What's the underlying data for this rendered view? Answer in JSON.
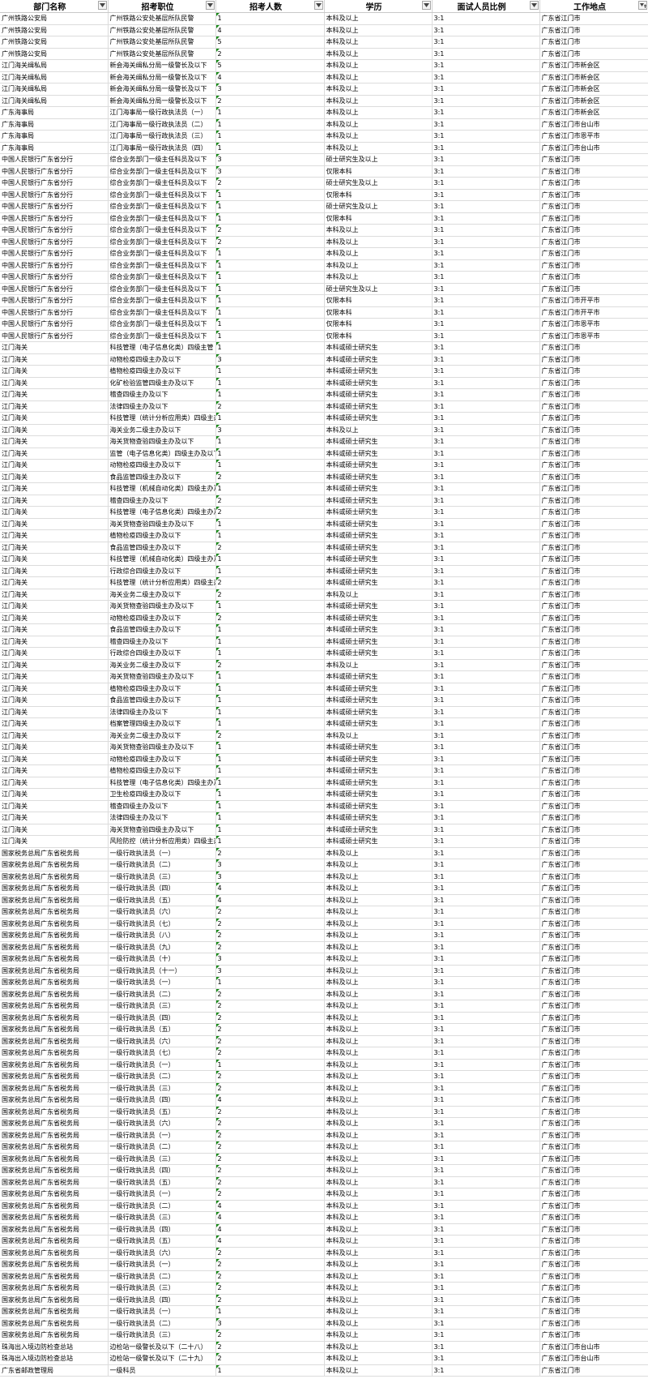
{
  "columns": [
    "部门名称",
    "招考职位",
    "招考人数",
    "学历",
    "面试人员比例",
    "工作地点"
  ],
  "rows": [
    [
      "广州铁路公安局",
      "广州铁路公安处基层所队民警",
      "1",
      "本科及以上",
      "3:1",
      "广东省江门市"
    ],
    [
      "广州铁路公安局",
      "广州铁路公安处基层所队民警",
      "4",
      "本科及以上",
      "3:1",
      "广东省江门市"
    ],
    [
      "广州铁路公安局",
      "广州铁路公安处基层所队民警",
      "5",
      "本科及以上",
      "3:1",
      "广东省江门市"
    ],
    [
      "广州铁路公安局",
      "广州铁路公安处基层所队民警",
      "2",
      "本科及以上",
      "3:1",
      "广东省江门市"
    ],
    [
      "江门海关缉私局",
      "新会海关缉私分局一级警长及以下",
      "5",
      "本科及以上",
      "3:1",
      "广东省江门市新会区"
    ],
    [
      "江门海关缉私局",
      "新会海关缉私分局一级警长及以下",
      "4",
      "本科及以上",
      "3:1",
      "广东省江门市新会区"
    ],
    [
      "江门海关缉私局",
      "新会海关缉私分局一级警长及以下",
      "3",
      "本科及以上",
      "3:1",
      "广东省江门市新会区"
    ],
    [
      "江门海关缉私局",
      "新会海关缉私分局一级警长及以下",
      "2",
      "本科及以上",
      "3:1",
      "广东省江门市新会区"
    ],
    [
      "广东海事局",
      "江门海事局一级行政执法员（一）",
      "1",
      "本科及以上",
      "3:1",
      "广东省江门市新会区"
    ],
    [
      "广东海事局",
      "江门海事局一级行政执法员（二）",
      "1",
      "本科及以上",
      "3:1",
      "广东省江门市台山市"
    ],
    [
      "广东海事局",
      "江门海事局一级行政执法员（三）",
      "1",
      "本科及以上",
      "3:1",
      "广东省江门市恩平市"
    ],
    [
      "广东海事局",
      "江门海事局一级行政执法员（四）",
      "1",
      "本科及以上",
      "3:1",
      "广东省江门市台山市"
    ],
    [
      "中国人民银行广东省分行",
      "综合业务部门一级主任科员及以下",
      "3",
      "硕士研究生及以上",
      "3:1",
      "广东省江门市"
    ],
    [
      "中国人民银行广东省分行",
      "综合业务部门一级主任科员及以下",
      "3",
      "仅限本科",
      "3:1",
      "广东省江门市"
    ],
    [
      "中国人民银行广东省分行",
      "综合业务部门一级主任科员及以下",
      "2",
      "硕士研究生及以上",
      "3:1",
      "广东省江门市"
    ],
    [
      "中国人民银行广东省分行",
      "综合业务部门一级主任科员及以下",
      "1",
      "仅限本科",
      "3:1",
      "广东省江门市"
    ],
    [
      "中国人民银行广东省分行",
      "综合业务部门一级主任科员及以下",
      "1",
      "硕士研究生及以上",
      "3:1",
      "广东省江门市"
    ],
    [
      "中国人民银行广东省分行",
      "综合业务部门一级主任科员及以下",
      "1",
      "仅限本科",
      "3:1",
      "广东省江门市"
    ],
    [
      "中国人民银行广东省分行",
      "综合业务部门一级主任科员及以下",
      "2",
      "本科及以上",
      "3:1",
      "广东省江门市"
    ],
    [
      "中国人民银行广东省分行",
      "综合业务部门一级主任科员及以下",
      "2",
      "本科及以上",
      "3:1",
      "广东省江门市"
    ],
    [
      "中国人民银行广东省分行",
      "综合业务部门一级主任科员及以下",
      "1",
      "本科及以上",
      "3:1",
      "广东省江门市"
    ],
    [
      "中国人民银行广东省分行",
      "综合业务部门一级主任科员及以下",
      "1",
      "本科及以上",
      "3:1",
      "广东省江门市"
    ],
    [
      "中国人民银行广东省分行",
      "综合业务部门一级主任科员及以下",
      "1",
      "本科及以上",
      "3:1",
      "广东省江门市"
    ],
    [
      "中国人民银行广东省分行",
      "综合业务部门一级主任科员及以下",
      "1",
      "硕士研究生及以上",
      "3:1",
      "广东省江门市"
    ],
    [
      "中国人民银行广东省分行",
      "综合业务部门一级主任科员及以下",
      "1",
      "仅限本科",
      "3:1",
      "广东省江门市开平市"
    ],
    [
      "中国人民银行广东省分行",
      "综合业务部门一级主任科员及以下",
      "1",
      "仅限本科",
      "3:1",
      "广东省江门市开平市"
    ],
    [
      "中国人民银行广东省分行",
      "综合业务部门一级主任科员及以下",
      "1",
      "仅限本科",
      "3:1",
      "广东省江门市恩平市"
    ],
    [
      "中国人民银行广东省分行",
      "综合业务部门一级主任科员及以下",
      "1",
      "仅限本科",
      "3:1",
      "广东省江门市恩平市"
    ],
    [
      "江门海关",
      "科技管理（电子信息化类）四级主管",
      "1",
      "本科或硕士研究生",
      "3:1",
      "广东省江门市"
    ],
    [
      "江门海关",
      "动物检疫四级主办及以下",
      "3",
      "本科或硕士研究生",
      "3:1",
      "广东省江门市"
    ],
    [
      "江门海关",
      "植物检疫四级主办及以下",
      "1",
      "本科或硕士研究生",
      "3:1",
      "广东省江门市"
    ],
    [
      "江门海关",
      "化矿检验监管四级主办及以下",
      "1",
      "本科或硕士研究生",
      "3:1",
      "广东省江门市"
    ],
    [
      "江门海关",
      "稽查四级主办及以下",
      "1",
      "本科或硕士研究生",
      "3:1",
      "广东省江门市"
    ],
    [
      "江门海关",
      "法律四级主办及以下",
      "2",
      "本科或硕士研究生",
      "3:1",
      "广东省江门市"
    ],
    [
      "江门海关",
      "科技管理（统计分析应用类）四级主办及以下",
      "1",
      "本科或硕士研究生",
      "3:1",
      "广东省江门市"
    ],
    [
      "江门海关",
      "海关业务二级主办及以下",
      "3",
      "本科及以上",
      "3:1",
      "广东省江门市"
    ],
    [
      "江门海关",
      "海关货物查验四级主办及以下",
      "1",
      "本科或硕士研究生",
      "3:1",
      "广东省江门市"
    ],
    [
      "江门海关",
      "监管（电子信息化类）四级主办及以下",
      "1",
      "本科或硕士研究生",
      "3:1",
      "广东省江门市"
    ],
    [
      "江门海关",
      "动物检疫四级主办及以下",
      "1",
      "本科或硕士研究生",
      "3:1",
      "广东省江门市"
    ],
    [
      "江门海关",
      "食品监管四级主办及以下",
      "2",
      "本科或硕士研究生",
      "3:1",
      "广东省江门市"
    ],
    [
      "江门海关",
      "科技管理（机械自动化类）四级主办及以下",
      "1",
      "本科或硕士研究生",
      "3:1",
      "广东省江门市"
    ],
    [
      "江门海关",
      "稽查四级主办及以下",
      "2",
      "本科或硕士研究生",
      "3:1",
      "广东省江门市"
    ],
    [
      "江门海关",
      "科技管理（电子信息化类）四级主办及以下",
      "2",
      "本科或硕士研究生",
      "3:1",
      "广东省江门市"
    ],
    [
      "江门海关",
      "海关货物查验四级主办及以下",
      "1",
      "本科或硕士研究生",
      "3:1",
      "广东省江门市"
    ],
    [
      "江门海关",
      "植物检疫四级主办及以下",
      "1",
      "本科或硕士研究生",
      "3:1",
      "广东省江门市"
    ],
    [
      "江门海关",
      "食品监管四级主办及以下",
      "2",
      "本科或硕士研究生",
      "3:1",
      "广东省江门市"
    ],
    [
      "江门海关",
      "科技管理（机械自动化类）四级主办及以下",
      "1",
      "本科或硕士研究生",
      "3:1",
      "广东省江门市"
    ],
    [
      "江门海关",
      "行政综合四级主办及以下",
      "1",
      "本科或硕士研究生",
      "3:1",
      "广东省江门市"
    ],
    [
      "江门海关",
      "科技管理（统计分析应用类）四级主办及以下",
      "2",
      "本科或硕士研究生",
      "3:1",
      "广东省江门市"
    ],
    [
      "江门海关",
      "海关业务二级主办及以下",
      "2",
      "本科及以上",
      "3:1",
      "广东省江门市"
    ],
    [
      "江门海关",
      "海关货物查验四级主办及以下",
      "1",
      "本科或硕士研究生",
      "3:1",
      "广东省江门市"
    ],
    [
      "江门海关",
      "动物检疫四级主办及以下",
      "2",
      "本科或硕士研究生",
      "3:1",
      "广东省江门市"
    ],
    [
      "江门海关",
      "食品监管四级主办及以下",
      "1",
      "本科或硕士研究生",
      "3:1",
      "广东省江门市"
    ],
    [
      "江门海关",
      "稽查四级主办及以下",
      "1",
      "本科或硕士研究生",
      "3:1",
      "广东省江门市"
    ],
    [
      "江门海关",
      "行政综合四级主办及以下",
      "1",
      "本科或硕士研究生",
      "3:1",
      "广东省江门市"
    ],
    [
      "江门海关",
      "海关业务二级主办及以下",
      "2",
      "本科及以上",
      "3:1",
      "广东省江门市"
    ],
    [
      "江门海关",
      "海关货物查验四级主办及以下",
      "1",
      "本科或硕士研究生",
      "3:1",
      "广东省江门市"
    ],
    [
      "江门海关",
      "植物检疫四级主办及以下",
      "1",
      "本科或硕士研究生",
      "3:1",
      "广东省江门市"
    ],
    [
      "江门海关",
      "食品监管四级主办及以下",
      "1",
      "本科或硕士研究生",
      "3:1",
      "广东省江门市"
    ],
    [
      "江门海关",
      "法律四级主办及以下",
      "1",
      "本科或硕士研究生",
      "3:1",
      "广东省江门市"
    ],
    [
      "江门海关",
      "档案管理四级主办及以下",
      "1",
      "本科或硕士研究生",
      "3:1",
      "广东省江门市"
    ],
    [
      "江门海关",
      "海关业务二级主办及以下",
      "2",
      "本科及以上",
      "3:1",
      "广东省江门市"
    ],
    [
      "江门海关",
      "海关货物查验四级主办及以下",
      "1",
      "本科或硕士研究生",
      "3:1",
      "广东省江门市"
    ],
    [
      "江门海关",
      "动物检疫四级主办及以下",
      "1",
      "本科或硕士研究生",
      "3:1",
      "广东省江门市"
    ],
    [
      "江门海关",
      "植物检疫四级主办及以下",
      "1",
      "本科或硕士研究生",
      "3:1",
      "广东省江门市"
    ],
    [
      "江门海关",
      "科技管理（电子信息化类）四级主办及以下",
      "1",
      "本科或硕士研究生",
      "3:1",
      "广东省江门市"
    ],
    [
      "江门海关",
      "卫生检疫四级主办及以下",
      "1",
      "本科或硕士研究生",
      "3:1",
      "广东省江门市"
    ],
    [
      "江门海关",
      "稽查四级主办及以下",
      "1",
      "本科或硕士研究生",
      "3:1",
      "广东省江门市"
    ],
    [
      "江门海关",
      "法律四级主办及以下",
      "1",
      "本科或硕士研究生",
      "3:1",
      "广东省江门市"
    ],
    [
      "江门海关",
      "海关货物查验四级主办及以下",
      "1",
      "本科或硕士研究生",
      "3:1",
      "广东省江门市"
    ],
    [
      "江门海关",
      "风险防控（统计分析应用类）四级主办及以下",
      "1",
      "本科或硕士研究生",
      "3:1",
      "广东省江门市"
    ],
    [
      "国家税务总局广东省税务局",
      "一级行政执法员（一）",
      "2",
      "本科及以上",
      "3:1",
      "广东省江门市"
    ],
    [
      "国家税务总局广东省税务局",
      "一级行政执法员（二）",
      "3",
      "本科及以上",
      "3:1",
      "广东省江门市"
    ],
    [
      "国家税务总局广东省税务局",
      "一级行政执法员（三）",
      "3",
      "本科及以上",
      "3:1",
      "广东省江门市"
    ],
    [
      "国家税务总局广东省税务局",
      "一级行政执法员（四）",
      "4",
      "本科及以上",
      "3:1",
      "广东省江门市"
    ],
    [
      "国家税务总局广东省税务局",
      "一级行政执法员（五）",
      "4",
      "本科及以上",
      "3:1",
      "广东省江门市"
    ],
    [
      "国家税务总局广东省税务局",
      "一级行政执法员（六）",
      "2",
      "本科及以上",
      "3:1",
      "广东省江门市"
    ],
    [
      "国家税务总局广东省税务局",
      "一级行政执法员（七）",
      "2",
      "本科及以上",
      "3:1",
      "广东省江门市"
    ],
    [
      "国家税务总局广东省税务局",
      "一级行政执法员（八）",
      "2",
      "本科及以上",
      "3:1",
      "广东省江门市"
    ],
    [
      "国家税务总局广东省税务局",
      "一级行政执法员（九）",
      "2",
      "本科及以上",
      "3:1",
      "广东省江门市"
    ],
    [
      "国家税务总局广东省税务局",
      "一级行政执法员（十）",
      "3",
      "本科及以上",
      "3:1",
      "广东省江门市"
    ],
    [
      "国家税务总局广东省税务局",
      "一级行政执法员（十一）",
      "3",
      "本科及以上",
      "3:1",
      "广东省江门市"
    ],
    [
      "国家税务总局广东省税务局",
      "一级行政执法员（一）",
      "1",
      "本科及以上",
      "3:1",
      "广东省江门市"
    ],
    [
      "国家税务总局广东省税务局",
      "一级行政执法员（二）",
      "2",
      "本科及以上",
      "3:1",
      "广东省江门市"
    ],
    [
      "国家税务总局广东省税务局",
      "一级行政执法员（三）",
      "2",
      "本科及以上",
      "3:1",
      "广东省江门市"
    ],
    [
      "国家税务总局广东省税务局",
      "一级行政执法员（四）",
      "2",
      "本科及以上",
      "3:1",
      "广东省江门市"
    ],
    [
      "国家税务总局广东省税务局",
      "一级行政执法员（五）",
      "2",
      "本科及以上",
      "3:1",
      "广东省江门市"
    ],
    [
      "国家税务总局广东省税务局",
      "一级行政执法员（六）",
      "2",
      "本科及以上",
      "3:1",
      "广东省江门市"
    ],
    [
      "国家税务总局广东省税务局",
      "一级行政执法员（七）",
      "2",
      "本科及以上",
      "3:1",
      "广东省江门市"
    ],
    [
      "国家税务总局广东省税务局",
      "一级行政执法员（一）",
      "1",
      "本科及以上",
      "3:1",
      "广东省江门市"
    ],
    [
      "国家税务总局广东省税务局",
      "一级行政执法员（二）",
      "2",
      "本科及以上",
      "3:1",
      "广东省江门市"
    ],
    [
      "国家税务总局广东省税务局",
      "一级行政执法员（三）",
      "2",
      "本科及以上",
      "3:1",
      "广东省江门市"
    ],
    [
      "国家税务总局广东省税务局",
      "一级行政执法员（四）",
      "4",
      "本科及以上",
      "3:1",
      "广东省江门市"
    ],
    [
      "国家税务总局广东省税务局",
      "一级行政执法员（五）",
      "2",
      "本科及以上",
      "3:1",
      "广东省江门市"
    ],
    [
      "国家税务总局广东省税务局",
      "一级行政执法员（六）",
      "2",
      "本科及以上",
      "3:1",
      "广东省江门市"
    ],
    [
      "国家税务总局广东省税务局",
      "一级行政执法员（一）",
      "2",
      "本科及以上",
      "3:1",
      "广东省江门市"
    ],
    [
      "国家税务总局广东省税务局",
      "一级行政执法员（二）",
      "2",
      "本科及以上",
      "3:1",
      "广东省江门市"
    ],
    [
      "国家税务总局广东省税务局",
      "一级行政执法员（三）",
      "2",
      "本科及以上",
      "3:1",
      "广东省江门市"
    ],
    [
      "国家税务总局广东省税务局",
      "一级行政执法员（四）",
      "2",
      "本科及以上",
      "3:1",
      "广东省江门市"
    ],
    [
      "国家税务总局广东省税务局",
      "一级行政执法员（五）",
      "2",
      "本科及以上",
      "3:1",
      "广东省江门市"
    ],
    [
      "国家税务总局广东省税务局",
      "一级行政执法员（一）",
      "2",
      "本科及以上",
      "3:1",
      "广东省江门市"
    ],
    [
      "国家税务总局广东省税务局",
      "一级行政执法员（二）",
      "4",
      "本科及以上",
      "3:1",
      "广东省江门市"
    ],
    [
      "国家税务总局广东省税务局",
      "一级行政执法员（三）",
      "4",
      "本科及以上",
      "3:1",
      "广东省江门市"
    ],
    [
      "国家税务总局广东省税务局",
      "一级行政执法员（四）",
      "4",
      "本科及以上",
      "3:1",
      "广东省江门市"
    ],
    [
      "国家税务总局广东省税务局",
      "一级行政执法员（五）",
      "4",
      "本科及以上",
      "3:1",
      "广东省江门市"
    ],
    [
      "国家税务总局广东省税务局",
      "一级行政执法员（六）",
      "2",
      "本科及以上",
      "3:1",
      "广东省江门市"
    ],
    [
      "国家税务总局广东省税务局",
      "一级行政执法员（一）",
      "2",
      "本科及以上",
      "3:1",
      "广东省江门市"
    ],
    [
      "国家税务总局广东省税务局",
      "一级行政执法员（二）",
      "2",
      "本科及以上",
      "3:1",
      "广东省江门市"
    ],
    [
      "国家税务总局广东省税务局",
      "一级行政执法员（三）",
      "2",
      "本科及以上",
      "3:1",
      "广东省江门市"
    ],
    [
      "国家税务总局广东省税务局",
      "一级行政执法员（四）",
      "2",
      "本科及以上",
      "3:1",
      "广东省江门市"
    ],
    [
      "国家税务总局广东省税务局",
      "一级行政执法员（一）",
      "1",
      "本科及以上",
      "3:1",
      "广东省江门市"
    ],
    [
      "国家税务总局广东省税务局",
      "一级行政执法员（二）",
      "3",
      "本科及以上",
      "3:1",
      "广东省江门市"
    ],
    [
      "国家税务总局广东省税务局",
      "一级行政执法员（三）",
      "2",
      "本科及以上",
      "3:1",
      "广东省江门市"
    ],
    [
      "珠海出入境边防检查总站",
      "边检站一级警长及以下（二十八）",
      "2",
      "本科及以上",
      "3:1",
      "广东省江门市台山市"
    ],
    [
      "珠海出入境边防检查总站",
      "边检站一级警长及以下（二十九）",
      "2",
      "本科及以上",
      "3:1",
      "广东省江门市台山市"
    ],
    [
      "广东省邮政管理局",
      "一级科员",
      "1",
      "本科及以上",
      "3:1",
      "广东省江门市"
    ]
  ]
}
